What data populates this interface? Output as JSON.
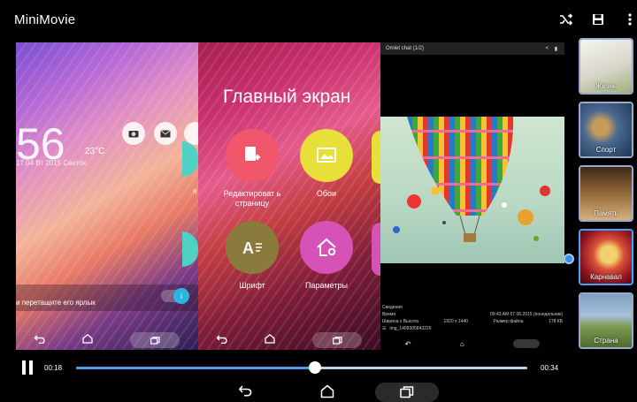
{
  "app": {
    "title": "MiniMovie"
  },
  "toolbar": {
    "shuffle_icon": "shuffle-icon",
    "save_icon": "save-icon",
    "more_icon": "more-vert-icon"
  },
  "preview": {
    "lockscreen": {
      "clock": "56",
      "temperature": "23°C",
      "date_line": "17:04 Вт 2015 Свиток",
      "side_label": "я",
      "drag_hint": "и перетащите его ярлык"
    },
    "home_screen": {
      "title": "Главный экран",
      "items": [
        {
          "label": "Редактироват ь страницу",
          "color": "#f0576a"
        },
        {
          "label": "Обои",
          "color": "#e8df3a"
        },
        {
          "label": "Шрифт",
          "color": "#8a7a3c"
        },
        {
          "label": "Параметры",
          "color": "#d652b6"
        }
      ]
    },
    "chat": {
      "header": "Omlet chat (1/2)",
      "info_title": "Сведения",
      "rows": [
        {
          "label": "Время",
          "value": "09:43 AM 07.06.2015 (понедельник)"
        },
        {
          "label": "Ширина x Высота",
          "value": "1920 x 1440",
          "extra_label": "Размер файла",
          "extra_value": "178 КБ"
        },
        {
          "label": "",
          "value": "img_1409305843226"
        }
      ]
    }
  },
  "themes": [
    {
      "label": "Жизнь",
      "colors": [
        "#e8e8e0",
        "#9fb07a"
      ]
    },
    {
      "label": "Спорт",
      "colors": [
        "#3a5f8a",
        "#c69b5d"
      ]
    },
    {
      "label": "Память",
      "colors": [
        "#6a4a2a",
        "#d8b07a"
      ]
    },
    {
      "label": "Карнавал",
      "colors": [
        "#b8202c",
        "#f2d26a"
      ],
      "selected": true
    },
    {
      "label": "Страна",
      "colors": [
        "#6f8fb4",
        "#7b9a4e"
      ]
    }
  ],
  "player": {
    "current_time": "00:18",
    "total_time": "00:34",
    "progress": 0.53
  },
  "colors": {
    "accent": "#4d9de8",
    "track": "#bcd2ea"
  }
}
